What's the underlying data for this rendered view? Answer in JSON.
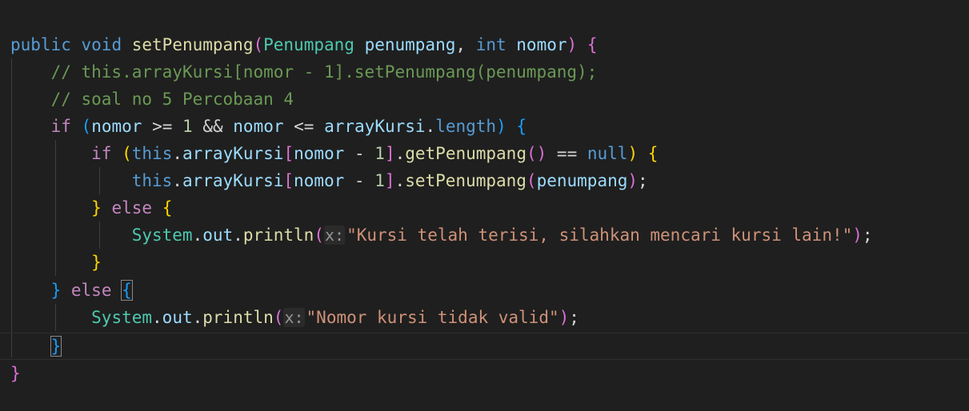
{
  "code": {
    "l1": {
      "kw_public": "public",
      "kw_void": "void",
      "fn_name": "setPenumpang",
      "p_open": "(",
      "t_penumpang": "Penumpang",
      "v_penumpang": "penumpang",
      "comma": ",",
      "kw_int": "int",
      "v_nomor": "nomor",
      "p_close": ")",
      "b_open": "{"
    },
    "l2": {
      "comment": "// this.arrayKursi[nomor - 1].setPenumpang(penumpang);"
    },
    "l3": {
      "comment": "// soal no 5 Percobaan 4"
    },
    "l4": {
      "kw_if": "if",
      "p_open": "(",
      "v_nomor1": "nomor",
      "op_ge": ">=",
      "n_1": "1",
      "op_and": "&&",
      "v_nomor2": "nomor",
      "op_le": "<=",
      "v_arr": "arrayKursi",
      "dot": ".",
      "v_length": "length",
      "p_close": ")",
      "b_open": "{"
    },
    "l5": {
      "kw_if": "if",
      "p_open": "(",
      "kw_this": "this",
      "dot1": ".",
      "v_arr": "arrayKursi",
      "br_open": "[",
      "v_nomor": "nomor",
      "op_minus": "-",
      "n_1": "1",
      "br_close": "]",
      "dot2": ".",
      "fn_get": "getPenumpang",
      "call_parens": "()",
      "op_eq": "==",
      "kw_null": "null",
      "p_close": ")",
      "b_open": "{"
    },
    "l6": {
      "kw_this": "this",
      "dot1": ".",
      "v_arr": "arrayKursi",
      "br_open": "[",
      "v_nomor": "nomor",
      "op_minus": "-",
      "n_1": "1",
      "br_close": "]",
      "dot2": ".",
      "fn_set": "setPenumpang",
      "p_open": "(",
      "v_penumpang": "penumpang",
      "p_close": ")",
      "semi": ";"
    },
    "l7": {
      "b_close": "}",
      "kw_else": "else",
      "b_open": "{"
    },
    "l8": {
      "t_system": "System",
      "dot1": ".",
      "v_out": "out",
      "dot2": ".",
      "fn_println": "println",
      "p_open": "(",
      "hint": "x:",
      "str": "\"Kursi telah terisi, silahkan mencari kursi lain!\"",
      "p_close": ")",
      "semi": ";"
    },
    "l9": {
      "b_close": "}"
    },
    "l10": {
      "b_close": "}",
      "kw_else": "else",
      "b_open": "{"
    },
    "l11": {
      "t_system": "System",
      "dot1": ".",
      "v_out": "out",
      "dot2": ".",
      "fn_println": "println",
      "p_open": "(",
      "hint": "x:",
      "str": "\"Nomor kursi tidak valid\"",
      "p_close": ")",
      "semi": ";"
    },
    "l12": {
      "b_close": "}"
    },
    "l13": {
      "b_close": "}"
    }
  },
  "colors": {
    "background": "#1f1f1f",
    "keyword": "#569cd6",
    "control_keyword": "#c586c0",
    "function": "#dcdcaa",
    "type": "#4ec9b0",
    "variable": "#9cdcfe",
    "number": "#b5cea8",
    "string": "#ce9178",
    "comment": "#6a9955",
    "bracket_level1": "#ffd700",
    "bracket_level2": "#da70d6",
    "bracket_level3": "#179fff"
  }
}
